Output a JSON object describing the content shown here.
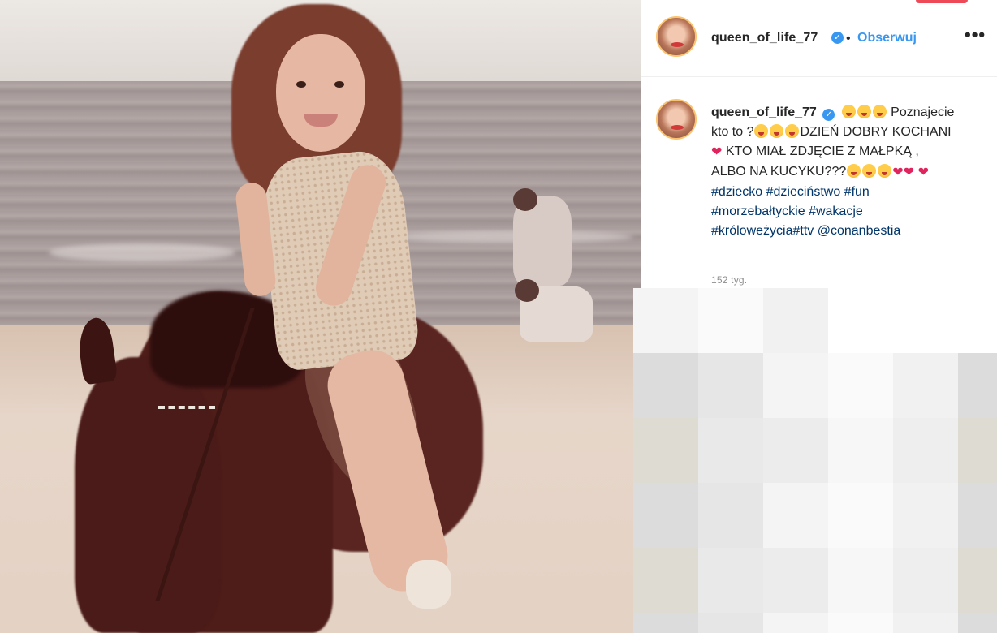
{
  "post": {
    "photo_alt": "photo",
    "username": "queen_of_life_77",
    "verified_symbol": "✓",
    "separator": "•",
    "follow_label": "Obserwuj",
    "more_label": "•••",
    "caption": {
      "username": "queen_of_life_77",
      "segments": [
        {
          "type": "emoji",
          "name": "tongue-face-emoji"
        },
        {
          "type": "emoji",
          "name": "tongue-face-emoji"
        },
        {
          "type": "emoji",
          "name": "tongue-face-emoji"
        },
        {
          "type": "text",
          "value": " Poznajecie kto to ?"
        },
        {
          "type": "emoji",
          "name": "tongue-face-emoji"
        },
        {
          "type": "emoji",
          "name": "tongue-face-emoji"
        },
        {
          "type": "emoji",
          "name": "tongue-face-emoji"
        },
        {
          "type": "text",
          "value": "DZIEŃ DOBRY KOCHANI"
        },
        {
          "type": "heart",
          "name": "broken-heart-emoji"
        },
        {
          "type": "text",
          "value": " KTO MIAŁ ZDJĘCIE Z MAŁPKĄ , ALBO NA KUCYKU???"
        },
        {
          "type": "emoji",
          "name": "tongue-face-emoji"
        },
        {
          "type": "emoji",
          "name": "tongue-face-emoji"
        },
        {
          "type": "emoji",
          "name": "tongue-face-emoji"
        },
        {
          "type": "heart",
          "name": "broken-heart-emoji"
        },
        {
          "type": "heart",
          "name": "broken-heart-emoji"
        },
        {
          "type": "text",
          "value": " "
        },
        {
          "type": "heart",
          "name": "broken-heart-emoji"
        },
        {
          "type": "tag",
          "value": "#dziecko"
        },
        {
          "type": "text",
          "value": " "
        },
        {
          "type": "tag",
          "value": "#dzieciństwo"
        },
        {
          "type": "text",
          "value": " "
        },
        {
          "type": "tag",
          "value": "#fun"
        },
        {
          "type": "text",
          "value": " "
        },
        {
          "type": "tag",
          "value": "#morzebałtyckie"
        },
        {
          "type": "text",
          "value": " "
        },
        {
          "type": "tag",
          "value": "#wakacje"
        },
        {
          "type": "text",
          "value": " "
        },
        {
          "type": "tag",
          "value": "#króloweżycia"
        },
        {
          "type": "tag",
          "value": "#ttv"
        },
        {
          "type": "text",
          "value": " "
        },
        {
          "type": "tag",
          "value": "@conanbestia"
        }
      ]
    },
    "time_ago": "152 tyg.",
    "colors": {
      "link_blue": "#3897f0",
      "text_dark": "#262626",
      "muted": "#8e8e8e",
      "hashtag": "#003569",
      "heart_red": "#e0245e"
    }
  }
}
